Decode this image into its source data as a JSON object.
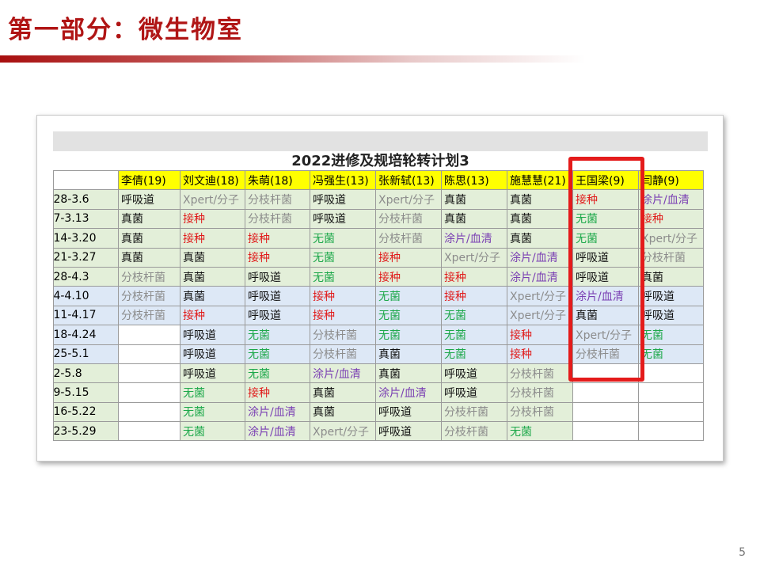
{
  "slide": {
    "title": "第一部分：微生物室",
    "page_number": "5"
  },
  "sheet": {
    "title": "2022进修及规培轮转计划3",
    "headers": [
      "",
      "李倩(19)",
      "刘文迪(18)",
      "朱萌(18)",
      "冯强生(13)",
      "张新轼(13)",
      "陈思(13)",
      "施慧慧(21)",
      "王国梁(9)",
      "闫静(9)"
    ],
    "rows": [
      {
        "date": ".28-3.6",
        "cells": [
          "呼吸道",
          "Xpert/分子",
          "分枝杆菌",
          "呼吸道",
          "Xpert/分子",
          "真菌",
          "真菌",
          "接种",
          "涂片/血清"
        ]
      },
      {
        "date": ".7-3.13",
        "cells": [
          "真菌",
          "接种",
          "分枝杆菌",
          "呼吸道",
          "分枝杆菌",
          "真菌",
          "真菌",
          "无菌",
          "接种"
        ]
      },
      {
        "date": ".14-3.20",
        "cells": [
          "真菌",
          "接种",
          "接种",
          "无菌",
          "分枝杆菌",
          "涂片/血清",
          "真菌",
          "无菌",
          "Xpert/分子"
        ]
      },
      {
        "date": ".21-3.27",
        "cells": [
          "真菌",
          "真菌",
          "接种",
          "无菌",
          "接种",
          "Xpert/分子",
          "涂片/血清",
          "呼吸道",
          "分枝杆菌"
        ]
      },
      {
        "date": ".28-4.3",
        "cells": [
          "分枝杆菌",
          "真菌",
          "呼吸道",
          "无菌",
          "接种",
          "接种",
          "涂片/血清",
          "呼吸道",
          "真菌"
        ]
      },
      {
        "date": ".4-4.10",
        "cells": [
          "分枝杆菌",
          "真菌",
          "呼吸道",
          "接种",
          "无菌",
          "接种",
          "Xpert/分子",
          "涂片/血清",
          "呼吸道"
        ]
      },
      {
        "date": ".11-4.17",
        "cells": [
          "分枝杆菌",
          "接种",
          "呼吸道",
          "接种",
          "无菌",
          "无菌",
          "Xpert/分子",
          "真菌",
          "呼吸道"
        ]
      },
      {
        "date": ".18-4.24",
        "cells": [
          "",
          "呼吸道",
          "无菌",
          "分枝杆菌",
          "无菌",
          "无菌",
          "接种",
          "Xpert/分子",
          "无菌"
        ]
      },
      {
        "date": ".25-5.1",
        "cells": [
          "",
          "呼吸道",
          "无菌",
          "分枝杆菌",
          "真菌",
          "无菌",
          "接种",
          "分枝杆菌",
          "无菌"
        ]
      },
      {
        "date": ".2-5.8",
        "cells": [
          "",
          "呼吸道",
          "无菌",
          "涂片/血清",
          "真菌",
          "呼吸道",
          "分枝杆菌",
          "",
          ""
        ]
      },
      {
        "date": ".9-5.15",
        "cells": [
          "",
          "无菌",
          "接种",
          "真菌",
          "涂片/血清",
          "呼吸道",
          "分枝杆菌",
          "",
          ""
        ]
      },
      {
        "date": ".16-5.22",
        "cells": [
          "",
          "无菌",
          "涂片/血清",
          "真菌",
          "呼吸道",
          "分枝杆菌",
          "分枝杆菌",
          "",
          ""
        ]
      },
      {
        "date": ".23-5.29",
        "cells": [
          "",
          "无菌",
          "涂片/血清",
          "Xpert/分子",
          "呼吸道",
          "分枝杆菌",
          "无菌",
          "",
          ""
        ]
      }
    ],
    "category_colors": {
      "呼吸道": "#111111",
      "真菌": "#111111",
      "接种": "#e01b1b",
      "无菌": "#1da84a",
      "分枝杆菌": "#8c8c8c",
      "Xpert/分子": "#8c8c8c",
      "涂片/血清": "#7a3fb3"
    }
  }
}
